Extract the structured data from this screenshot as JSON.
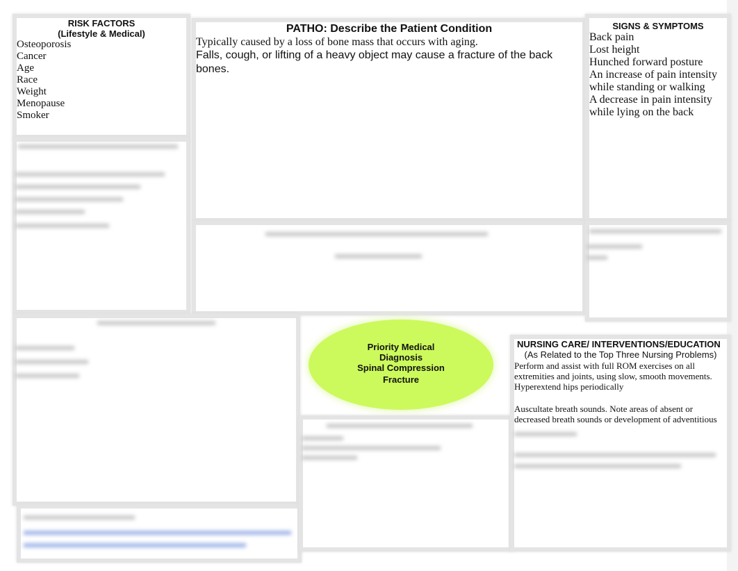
{
  "risk_factors": {
    "title": "RISK FACTORS",
    "subtitle": "(Lifestyle & Medical)",
    "items": [
      "Osteoporosis",
      "Cancer",
      "Age",
      "Race",
      "Weight",
      "Menopause",
      "Smoker"
    ]
  },
  "patho": {
    "title": "PATHO:  Describe the Patient Condition",
    "line1": "Typically caused by a loss of bone mass that occurs with aging.",
    "line2": "Falls, cough, or lifting of a heavy object may cause a fracture of the back bones."
  },
  "signs": {
    "title": "SIGNS & SYMPTOMS",
    "items": [
      "Back pain",
      "Lost height",
      "Hunched forward posture",
      "An increase of pain intensity while standing or walking",
      "A decrease in pain intensity while lying on the back"
    ]
  },
  "diagnosis": {
    "line1": "Priority Medical",
    "line2": "Diagnosis",
    "line3": "Spinal Compression",
    "line4": "Fracture",
    "color": "#ccfa5c"
  },
  "nursing": {
    "title": "NURSING CARE/ INTERVENTIONS/EDUCATION",
    "subtitle": "(As Related to the Top Three Nursing Problems)",
    "p1": "Perform and assist with full ROM exercises on all extremities and joints, using slow, smooth movements. Hyperextend hips periodically",
    "p2": "Auscultate breath sounds. Note areas of absent or decreased breath sounds or development of adventitious"
  }
}
